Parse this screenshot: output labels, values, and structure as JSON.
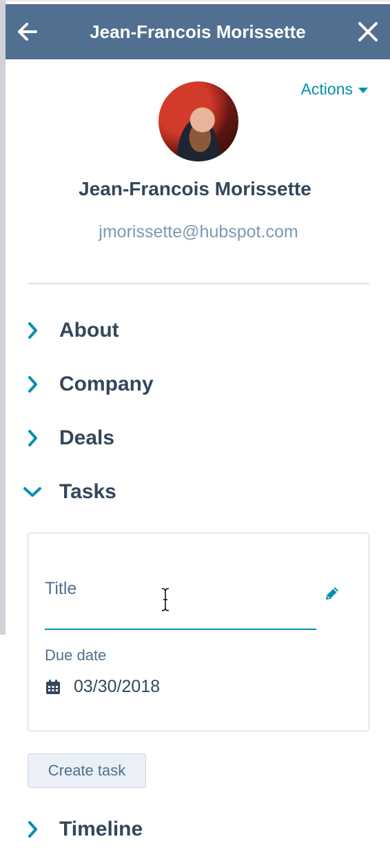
{
  "header": {
    "title": "Jean-Francois Morissette",
    "back_icon": "arrow-left-icon",
    "close_icon": "close-icon",
    "background": "#516f90"
  },
  "profile": {
    "actions_label": "Actions",
    "name": "Jean-Francois Morissette",
    "email": "jmorissette@hubspot.com"
  },
  "sections": {
    "about": "About",
    "company": "Company",
    "deals": "Deals",
    "tasks": "Tasks",
    "timeline": "Timeline"
  },
  "task_form": {
    "title_placeholder": "Title",
    "title_value": "",
    "due_date_label": "Due date",
    "due_date_value": "03/30/2018",
    "create_button_label": "Create task"
  },
  "colors": {
    "accent": "#0091ae",
    "text_dark": "#33475b",
    "text_muted": "#7c98b6"
  }
}
